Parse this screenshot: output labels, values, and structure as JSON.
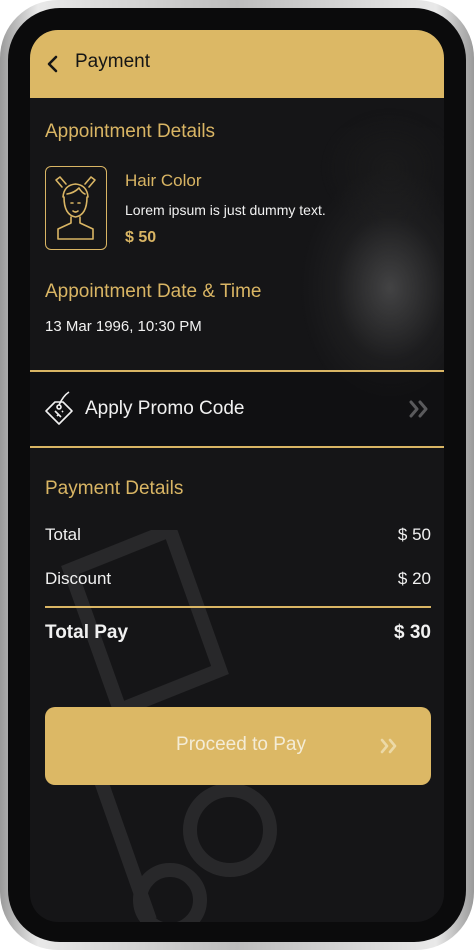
{
  "header": {
    "title": "Payment",
    "back_icon": "chevron-left-icon"
  },
  "appointment": {
    "section_title": "Appointment Details",
    "service_icon": "hair-salon-face-icon",
    "service_name": "Hair Color",
    "service_description": "Lorem ipsum is just dummy text.",
    "service_price": "$ 50"
  },
  "schedule": {
    "section_title": "Appointment Date & Time",
    "datetime": "13 Mar 1996, 10:30 PM"
  },
  "promo": {
    "label": "Apply Promo Code",
    "icon": "tag-icon"
  },
  "payment": {
    "section_title": "Payment Details",
    "rows": [
      {
        "label": "Total",
        "value": "$ 50"
      },
      {
        "label": "Discount",
        "value": "$ 20"
      }
    ],
    "total_label": "Total Pay",
    "total_value": "$ 30"
  },
  "cta": {
    "label": "Proceed to Pay"
  },
  "colors": {
    "accent": "#dcb865",
    "background": "#151517",
    "text": "#f1f1f1"
  }
}
